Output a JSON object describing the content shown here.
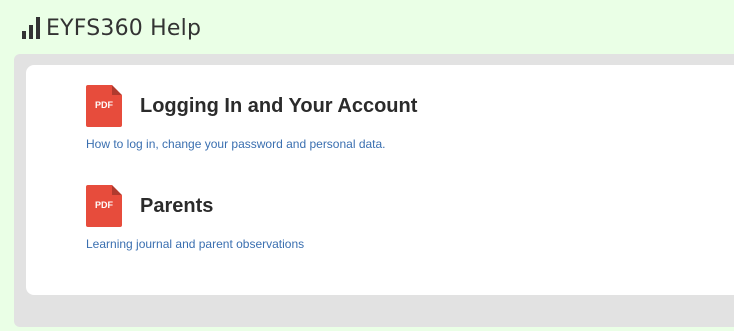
{
  "header": {
    "title": "EYFS360 Help",
    "icon": "signal-bars-icon"
  },
  "documents": [
    {
      "icon": "pdf-icon",
      "icon_label": "PDF",
      "title": "Logging In and Your Account",
      "description": "How to log in, change your password and personal data."
    },
    {
      "icon": "pdf-icon",
      "icon_label": "PDF",
      "title": "Parents",
      "description": "Learning journal and parent observations"
    }
  ],
  "colors": {
    "background": "#eaffe6",
    "pdf_red": "#e74c3c",
    "link_blue": "#3a6fb0"
  }
}
